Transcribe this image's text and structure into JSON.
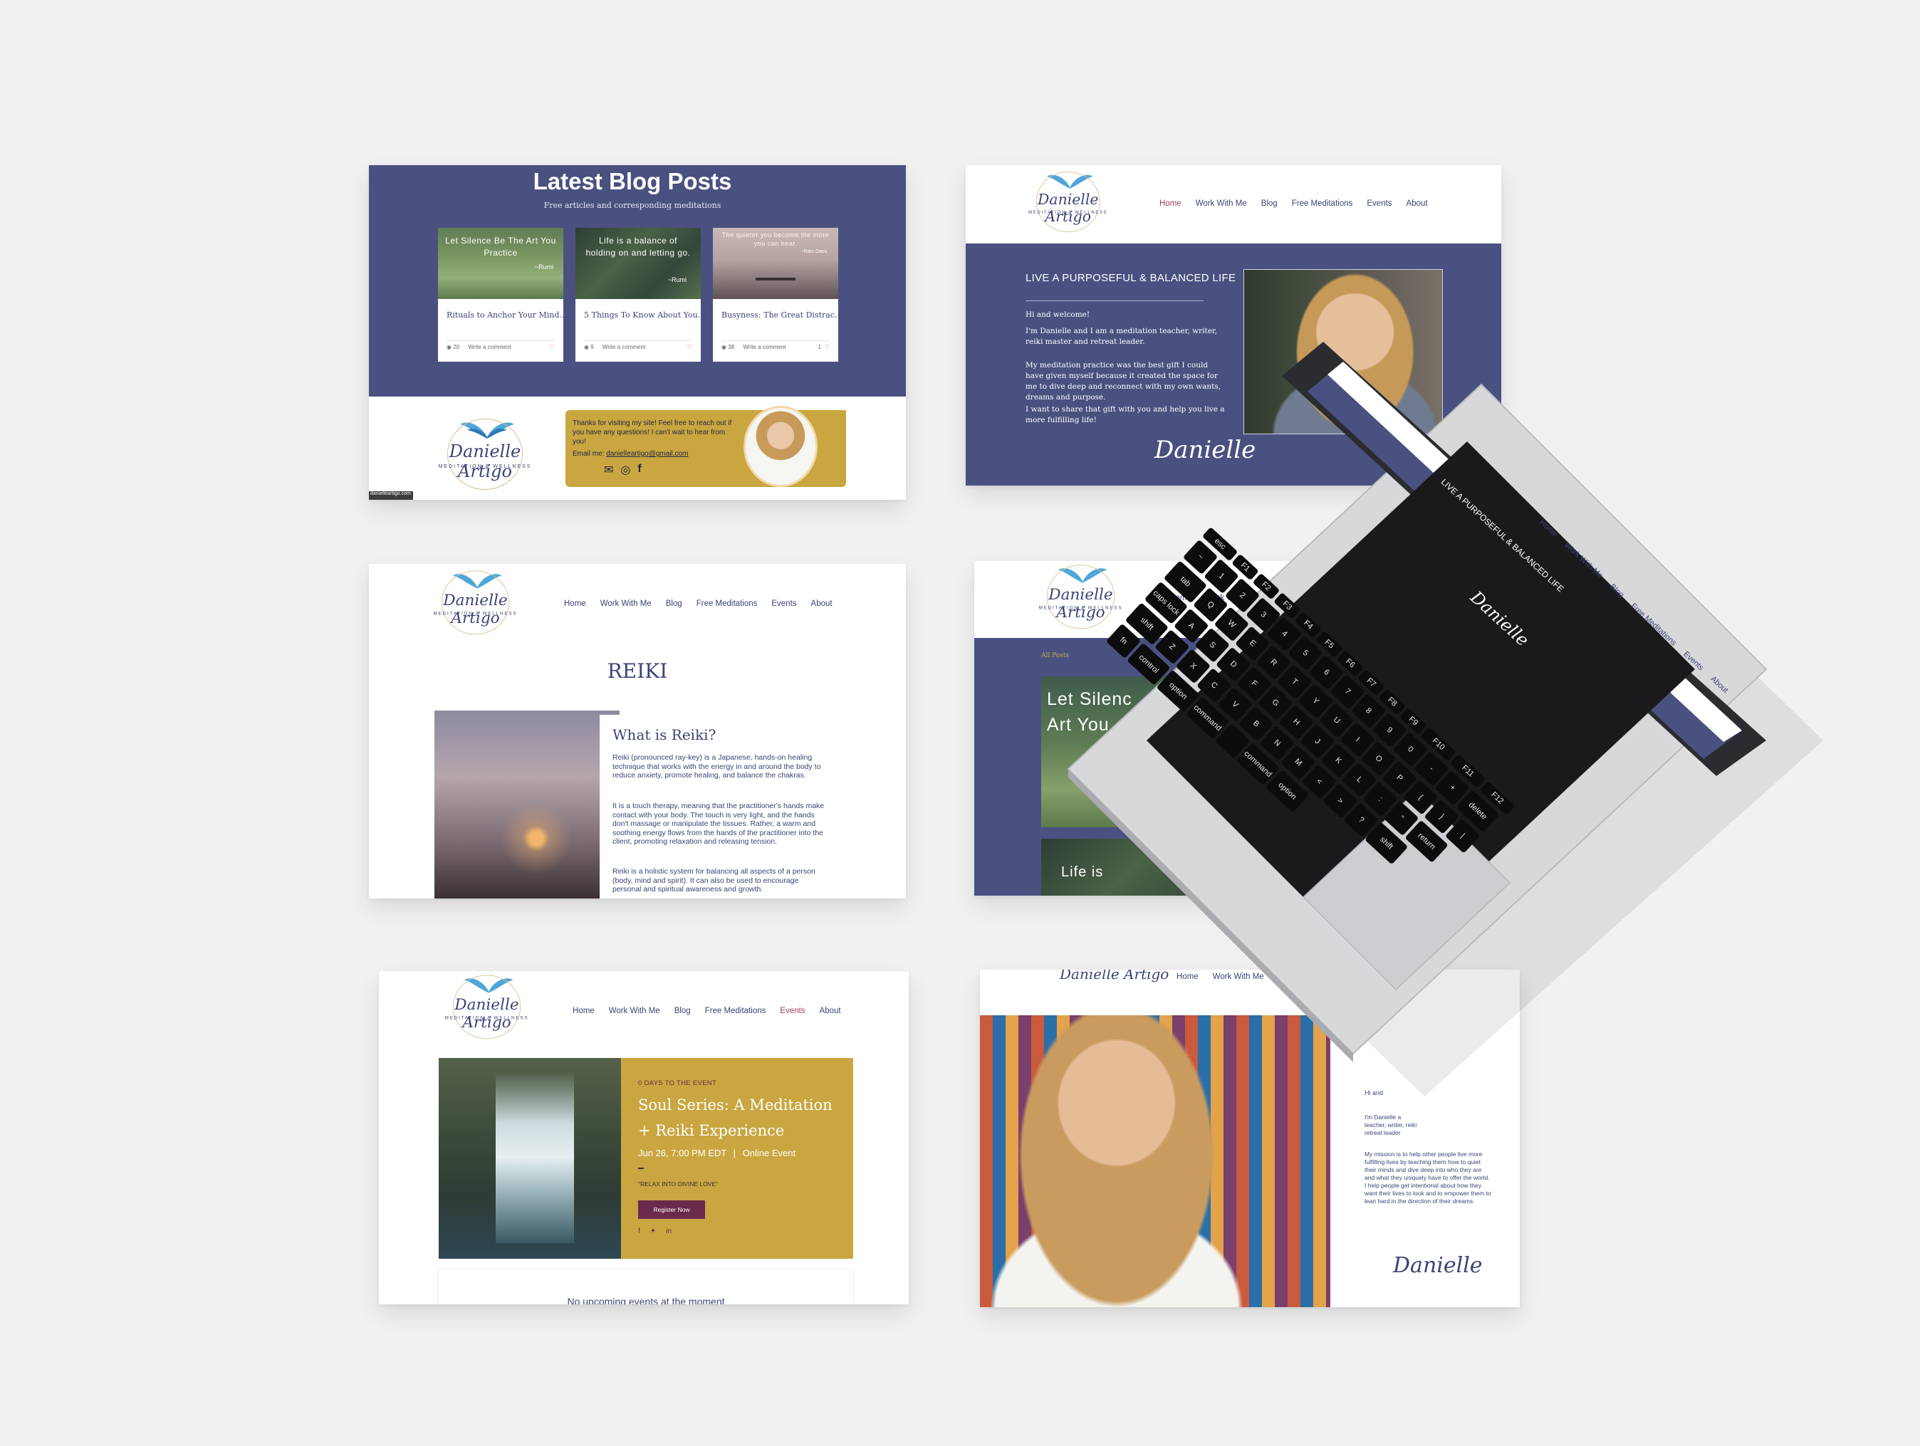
{
  "brand": {
    "name_script": "Danielle Artigo",
    "tagline": "MEDITATION & WELLNESS",
    "signature": "Danielle"
  },
  "nav": [
    "Home",
    "Work With Me",
    "Blog",
    "Free Meditations",
    "Events",
    "About"
  ],
  "colors": {
    "navy": "#4a5180",
    "gold": "#c9a640",
    "plum": "#6a2a4c",
    "white": "#ffffff"
  },
  "blog": {
    "title": "Latest Blog Posts",
    "subtitle": "Free articles and corresponding meditations",
    "posts": [
      {
        "quote": "Let Silence Be The Art You Practice",
        "attribution": "~Rumi",
        "title": "Rituals to Anchor Your Mind...",
        "views": "20",
        "comment": "Write a comment",
        "likes": ""
      },
      {
        "quote": "Life is a balance of holding on and letting go.",
        "attribution": "~Rumi",
        "title": "5 Things To Know About You...",
        "views": "9",
        "comment": "Write a comment",
        "likes": ""
      },
      {
        "quote": "The quieter you become the more you can hear.",
        "attribution": "~Ram Dass",
        "title": "Busyness: The Great Distrac...",
        "views": "38",
        "comment": "Write a comment",
        "likes": "1"
      }
    ],
    "contact": {
      "message": "Thanks for visiting my site! Feel free to reach out if you have any questions! I can't wait to hear from you!",
      "email_label": "Email me:",
      "email": "danielleartigo@gmail.com"
    },
    "url_badge": "danielleartigo.com"
  },
  "home": {
    "headline": "LIVE A PURPOSEFUL & BALANCED LIFE",
    "greeting": "Hi and welcome!",
    "p1": "I'm Danielle and I am a meditation teacher, writer, reiki master and retreat leader.",
    "p2": "My meditation practice was the best gift I could have given myself because it created the space for me to dive deep and reconnect with my own wants, dreams and purpose.",
    "p3": "I want to share that gift with you and help you live a more fulfilling life!"
  },
  "reiki": {
    "title": "REIKI",
    "subtitle": "What is Reiki?",
    "p1": "Reiki (pronounced ray-key) is a Japanese, hands-on healing technique that works with the energy in and around the body to reduce anxiety, promote healing, and balance the chakras.",
    "p2": "It is a touch therapy, meaning that the practitioner's hands make contact with your body. The touch is very light, and the hands don't massage or manipulate the tissues. Rather, a warm and soothing energy flows from the hands of the practitioner into the client, promoting relaxation and releasing tension.",
    "p3": "Reiki is a holistic system for balancing all aspects of a person (body, mind and spirit). It can also be used to encourage personal and spiritual awareness and growth."
  },
  "blog_page": {
    "all_posts": "All Posts",
    "tile1": "Let Silence Be The Art You Practice",
    "tile1_visible": "Let Silenc Art You",
    "tile2_visible": "Life is"
  },
  "events": {
    "countdown": "0 DAYS TO THE EVENT",
    "title": "Soul Series: A Meditation + Reiki Experience",
    "date": "Jun 26, 7:00 PM EDT",
    "location": "Online Event",
    "quote": "\"RELAX INTO DIVINE LOVE\"",
    "register": "Register Now",
    "empty": "No upcoming events at the moment"
  },
  "about": {
    "greeting": "Hi and",
    "p1": "I'm Danielle a teacher, writer, reiki retreat leader",
    "p2": "My mission is to help other people live more fulfilling lives by teaching them how to quiet their minds and dive deep into who they are and what they uniquely have to offer the world. I help people get intentional about how they want their lives to look and to empower them to lean hard in the direction of their dreams."
  },
  "laptop": {
    "keys_row1": [
      "esc",
      "F1",
      "F2",
      "F3",
      "F4",
      "F5",
      "F6",
      "F7",
      "F8",
      "F9",
      "F10",
      "F11",
      "F12"
    ],
    "keys_row2": [
      "~",
      "1",
      "2",
      "3",
      "4",
      "5",
      "6",
      "7",
      "8",
      "9",
      "0",
      "-",
      "+",
      "delete"
    ],
    "keys_row3": [
      "tab",
      "Q",
      "W",
      "E",
      "R",
      "T",
      "Y",
      "U",
      "I",
      "O",
      "P",
      "{",
      "}",
      "|"
    ],
    "keys_row4": [
      "caps lock",
      "A",
      "S",
      "D",
      "F",
      "G",
      "H",
      "J",
      "K",
      "L",
      ":",
      "\"",
      "return"
    ],
    "keys_row5": [
      "shift",
      "Z",
      "X",
      "C",
      "V",
      "B",
      "N",
      "M",
      "<",
      ">",
      "?",
      "shift"
    ],
    "keys_row6": [
      "fn",
      "control",
      "option",
      "command",
      "",
      "command",
      "option"
    ]
  }
}
